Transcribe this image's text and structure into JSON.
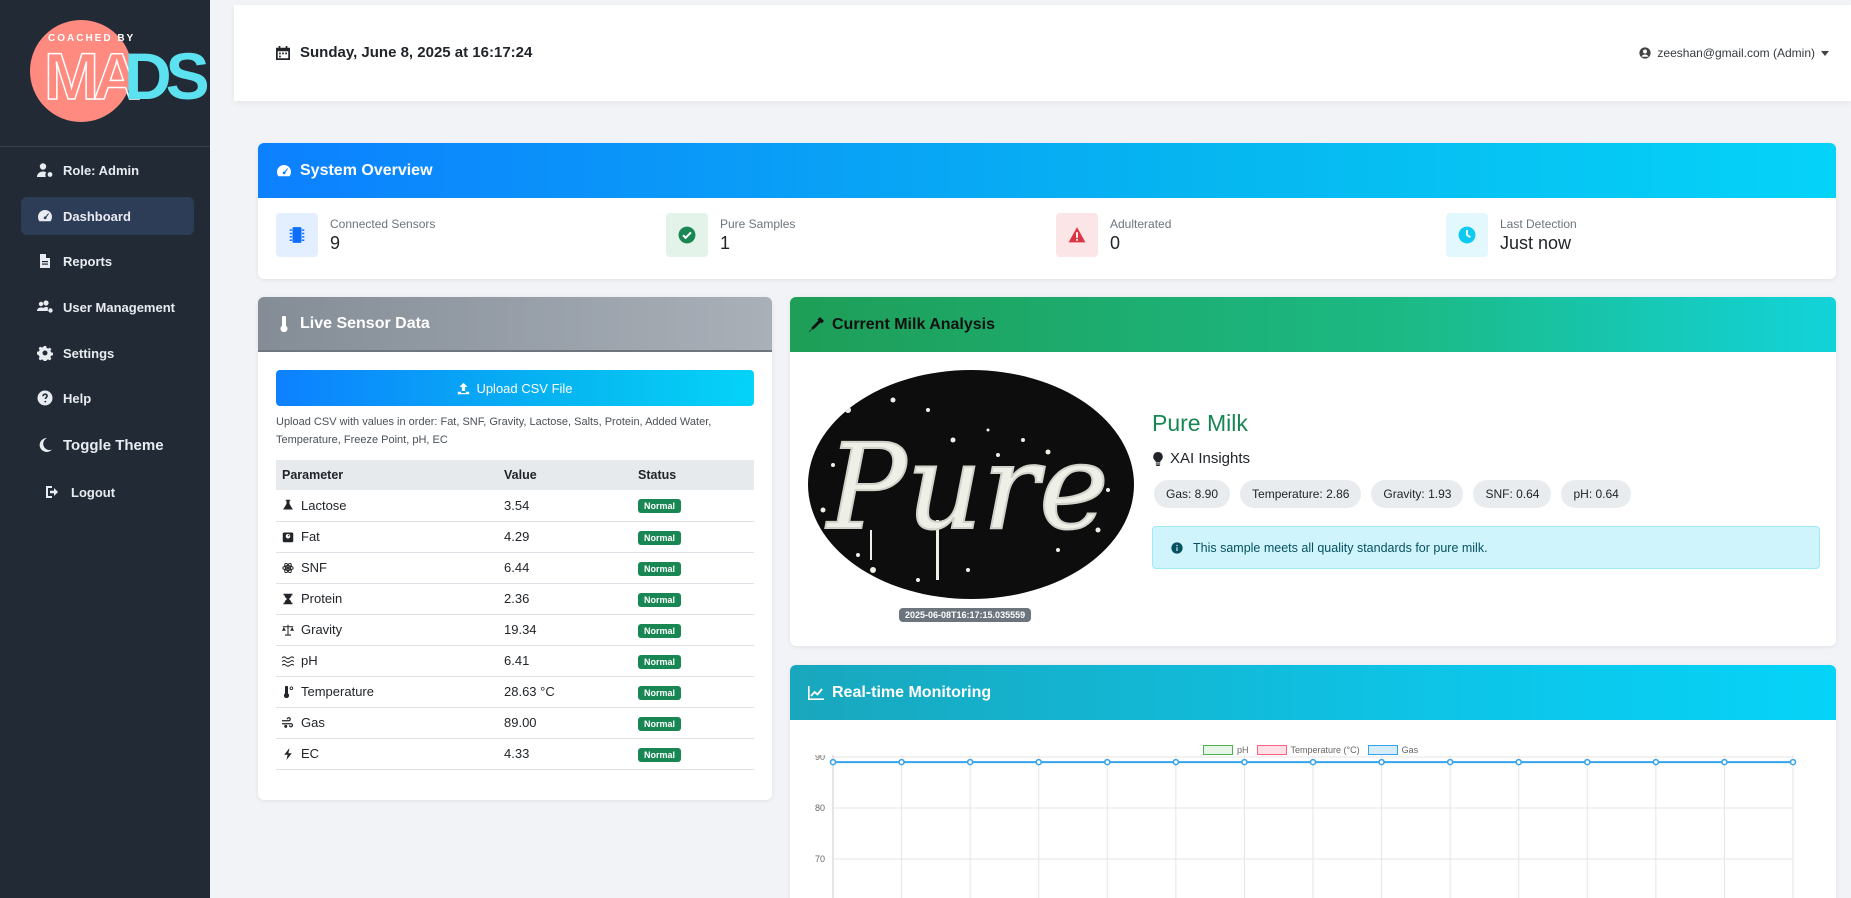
{
  "sidebar": {
    "logo": {
      "tagline": "COACHED BY",
      "mark_left": "MA",
      "mark_right": "DS"
    },
    "items": [
      {
        "label": "Role: Admin",
        "icon": "user-gear-icon"
      },
      {
        "label": "Dashboard",
        "icon": "gauge-icon",
        "active": true
      },
      {
        "label": "Reports",
        "icon": "file-icon"
      },
      {
        "label": "User Management",
        "icon": "users-gear-icon"
      },
      {
        "label": "Settings",
        "icon": "gear-icon"
      },
      {
        "label": "Help",
        "icon": "question-icon"
      },
      {
        "label": "Toggle Theme",
        "icon": "moon-icon"
      },
      {
        "label": "Logout",
        "icon": "logout-icon"
      }
    ]
  },
  "topbar": {
    "datetime": "Sunday, June 8, 2025 at 16:17:24",
    "user": "zeeshan@gmail.com (Admin)"
  },
  "overview": {
    "title": "System Overview",
    "stats": [
      {
        "label": "Connected Sensors",
        "value": "9",
        "icon": "chip-icon",
        "color": "#0d6efd"
      },
      {
        "label": "Pure Samples",
        "value": "1",
        "icon": "check-circle-icon",
        "color": "#198754"
      },
      {
        "label": "Adulterated",
        "value": "0",
        "icon": "warning-icon",
        "color": "#dc3545"
      },
      {
        "label": "Last Detection",
        "value": "Just now",
        "icon": "clock-icon",
        "color": "#0dcaf0"
      }
    ]
  },
  "sensors": {
    "title": "Live Sensor Data",
    "upload_label": "Upload CSV File",
    "upload_note": "Upload CSV with values in order: Fat, SNF, Gravity, Lactose, Salts, Protein, Added Water, Temperature, Freeze Point, pH, EC",
    "columns": [
      "Parameter",
      "Value",
      "Status"
    ],
    "rows": [
      {
        "param": "Lactose",
        "value": "3.54",
        "status": "Normal",
        "icon": "flask-icon"
      },
      {
        "param": "Fat",
        "value": "4.29",
        "status": "Normal",
        "icon": "weight-scale-icon"
      },
      {
        "param": "SNF",
        "value": "6.44",
        "status": "Normal",
        "icon": "atom-icon"
      },
      {
        "param": "Protein",
        "value": "2.36",
        "status": "Normal",
        "icon": "hourglass-icon"
      },
      {
        "param": "Gravity",
        "value": "19.34",
        "status": "Normal",
        "icon": "balance-icon"
      },
      {
        "param": "pH",
        "value": "6.41",
        "status": "Normal",
        "icon": "water-icon"
      },
      {
        "param": "Temperature",
        "value": "28.63 °C",
        "status": "Normal",
        "icon": "thermometer-icon"
      },
      {
        "param": "Gas",
        "value": "89.00",
        "status": "Normal",
        "icon": "wind-icon"
      },
      {
        "param": "EC",
        "value": "4.33",
        "status": "Normal",
        "icon": "bolt-icon"
      }
    ]
  },
  "analysis": {
    "title": "Current Milk Analysis",
    "image_text": "Pure",
    "timestamp": "2025-06-08T16:17:15.035559",
    "result": "Pure Milk",
    "result_color": "#198754",
    "xai_title": "XAI Insights",
    "insights": [
      "Gas: 8.90",
      "Temperature: 2.86",
      "Gravity: 1.93",
      "SNF: 0.64",
      "pH: 0.64"
    ],
    "message": "This sample meets all quality standards for pure milk."
  },
  "monitoring": {
    "title": "Real-time Monitoring"
  },
  "chart_data": {
    "type": "line",
    "legend": [
      "pH",
      "Temperature (°C)",
      "Gas"
    ],
    "legend_colors": [
      "#4caf50",
      "#ff6384",
      "#36a2eb"
    ],
    "yticks": [
      90,
      80,
      70
    ],
    "series": [
      {
        "name": "Gas",
        "values": [
          89,
          89,
          89,
          89,
          89,
          89,
          89,
          89,
          89,
          89,
          89,
          89,
          89,
          89,
          89
        ]
      }
    ],
    "grid": true,
    "legend_position": "top"
  }
}
